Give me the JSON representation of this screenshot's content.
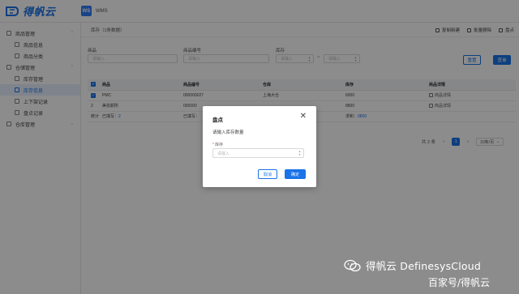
{
  "header": {
    "logo_text": "得帆云",
    "app_badge": "WS",
    "app_name": "WMS"
  },
  "sidebar": {
    "items": [
      {
        "label": "商品管理",
        "level": 0,
        "chevron": "⌃"
      },
      {
        "label": "商品信息",
        "level": 1
      },
      {
        "label": "商品分类",
        "level": 1
      },
      {
        "label": "仓储管理",
        "level": 0,
        "chevron": "⌃"
      },
      {
        "label": "库存管理",
        "level": 1
      },
      {
        "label": "库存信息",
        "level": 1,
        "active": true
      },
      {
        "label": "上下架记录",
        "level": 1
      },
      {
        "label": "盘点记录",
        "level": 1
      },
      {
        "label": "仓库管理",
        "level": 0,
        "chevron": "⌄"
      }
    ],
    "collapse_glyph": "‹"
  },
  "page": {
    "tab_label": "库存（1条数据）",
    "tools": [
      "复制新建",
      "批量删除",
      "盘点"
    ]
  },
  "filters": {
    "product_label": "商品",
    "product_placeholder": "请输入",
    "code_label": "商品编号",
    "code_placeholder": "请输入",
    "stock_label": "库存",
    "stock_min_placeholder": "请输入",
    "stock_max_placeholder": "请输入",
    "range_sep": "~",
    "reset_label": "重置",
    "search_label": "查询"
  },
  "table": {
    "columns": [
      "商品",
      "商品编号",
      "仓库",
      "库存",
      "商品详情"
    ],
    "rows": [
      {
        "check": "✓",
        "product": "PMC",
        "code": "000000027",
        "warehouse": "上海大仓",
        "stock": "6000",
        "detail": "商品详情"
      },
      {
        "check": "2",
        "product": "美妆颜所",
        "code": "000000",
        "warehouse": "",
        "stock": "8800",
        "detail": "商品详情"
      }
    ],
    "footer": {
      "label": "统计",
      "selected_label": "已填写：",
      "selected_value": "2",
      "selected_label2": "已填写：",
      "sum_label": "求和：",
      "sum_value": "9800"
    }
  },
  "pagination": {
    "total": "共 2 条",
    "prev": "‹",
    "current": "1",
    "next": "›",
    "page_size": "10条/页"
  },
  "modal": {
    "title": "盘点",
    "close": "✕",
    "hint": "请输入库存数量",
    "field_required": "*",
    "field_label": "库存",
    "field_placeholder": "请输入",
    "cancel_label": "取消",
    "ok_label": "确定"
  },
  "watermark": {
    "line1": "得帆云 DefinesysCloud",
    "line2": "百家号/得帆云"
  },
  "colors": {
    "primary": "#1a73e8",
    "overlay": "rgba(0,0,0,0.45)"
  }
}
